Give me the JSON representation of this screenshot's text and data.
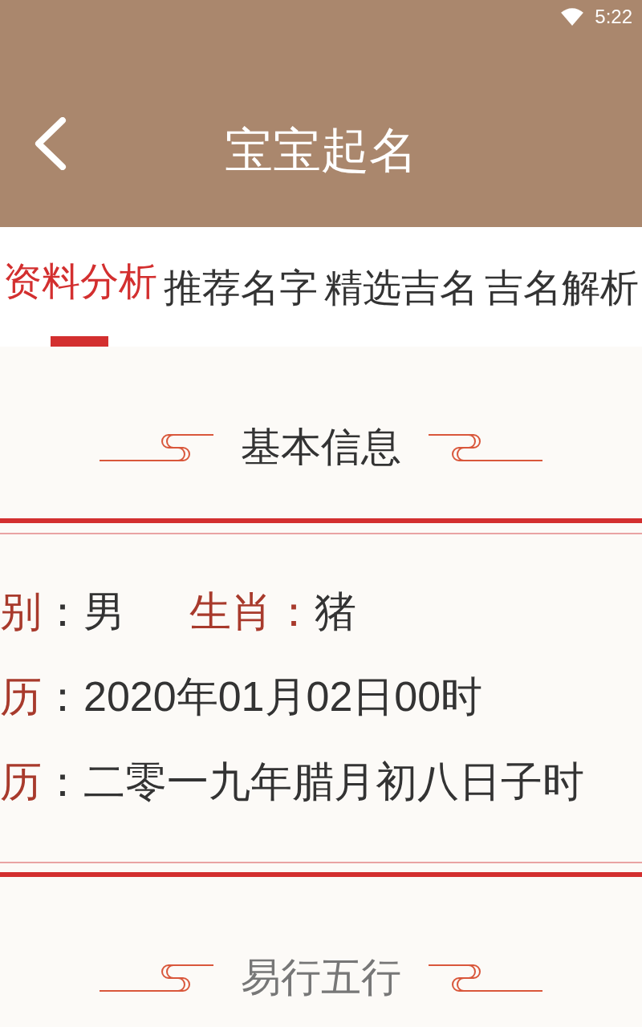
{
  "status_bar": {
    "time": "5:22"
  },
  "header": {
    "title": "宝宝起名"
  },
  "tabs": [
    {
      "label": "资料分析",
      "selected": true
    },
    {
      "label": "推荐名字",
      "selected": false
    },
    {
      "label": "精选吉名",
      "selected": false
    },
    {
      "label": "吉名解析",
      "selected": false
    }
  ],
  "sections": [
    {
      "kind": "panel",
      "title": "基本信息",
      "rows": [
        {
          "fields": [
            {
              "label": "别",
              "value": "：男"
            },
            {
              "label": "生肖：",
              "value": "猪"
            }
          ]
        },
        {
          "fields": [
            {
              "label": "历",
              "value": "：2020年01月02日00时"
            }
          ]
        },
        {
          "fields": [
            {
              "label": "历",
              "value": "：二零一九年腊月初八日子时"
            }
          ]
        }
      ]
    },
    {
      "kind": "heading",
      "title": "易行五行"
    }
  ]
}
